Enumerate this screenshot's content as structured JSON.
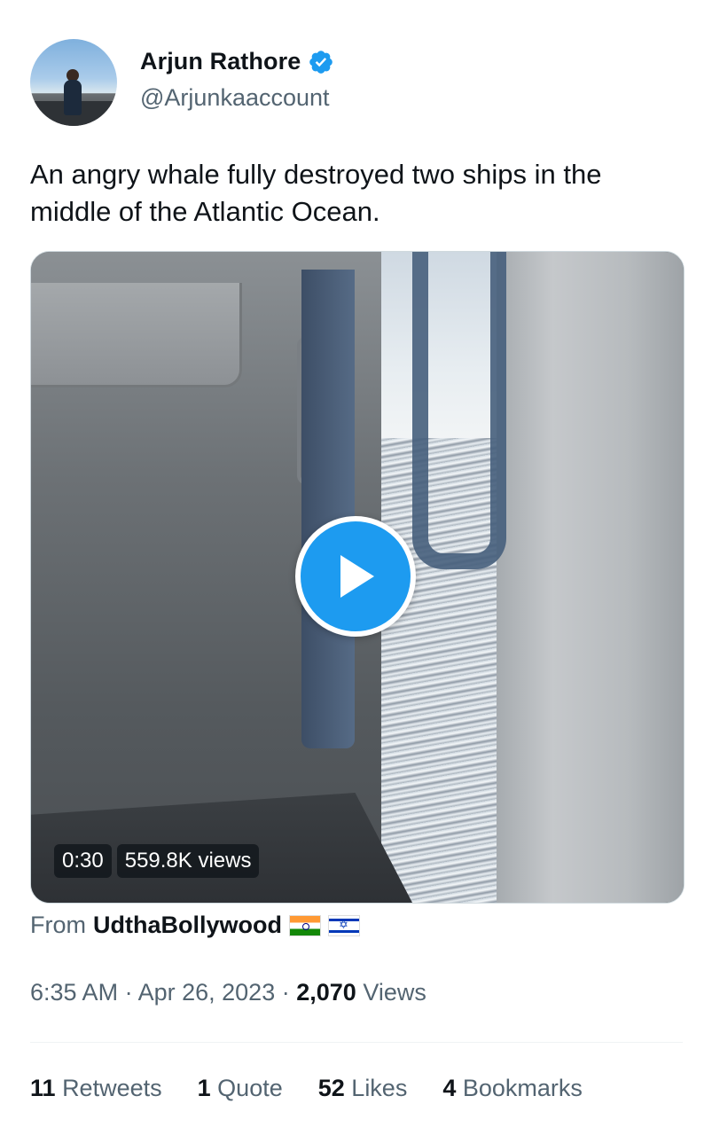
{
  "user": {
    "name": "Arjun Rathore",
    "handle": "@Arjunkaaccount",
    "verified_color": "#1d9bf0"
  },
  "tweet": {
    "text": "An angry whale fully destroyed two ships in the middle of the Atlantic Ocean."
  },
  "media": {
    "duration": "0:30",
    "views": "559.8K views",
    "play_color": "#1d9bf0"
  },
  "source": {
    "prefix": "From",
    "account": "UdthaBollywood",
    "flags": [
      "india-flag-icon",
      "israel-flag-icon"
    ]
  },
  "meta": {
    "time": "6:35 AM",
    "date": "Apr 26, 2023",
    "views_count": "2,070",
    "views_label": "Views",
    "separator": "·"
  },
  "stats": [
    {
      "count": "11",
      "label": "Retweets"
    },
    {
      "count": "1",
      "label": "Quote"
    },
    {
      "count": "52",
      "label": "Likes"
    },
    {
      "count": "4",
      "label": "Bookmarks"
    }
  ]
}
